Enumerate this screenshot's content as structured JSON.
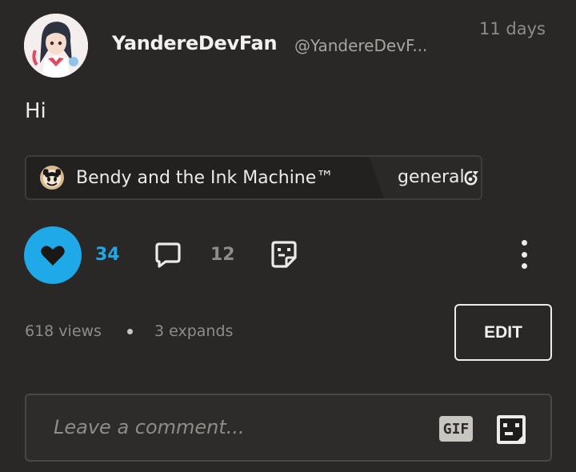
{
  "post": {
    "username": "YandereDevFan",
    "handle": "@YandereDevF...",
    "timestamp": "11 days",
    "body": "Hi"
  },
  "tag": {
    "game_name": "Bendy and the Ink Machine™",
    "channel": "general",
    "game_icon": "bendy-icon",
    "channel_icon": "channel-icon"
  },
  "actions": {
    "like_count": "34",
    "comment_count": "12",
    "liked": true,
    "accent_color": "#1fa9e8"
  },
  "stats": {
    "views": "618 views",
    "expands": "3 expands"
  },
  "edit_label": "EDIT",
  "comment": {
    "placeholder": "Leave a comment...",
    "gif_label": "GIF"
  }
}
